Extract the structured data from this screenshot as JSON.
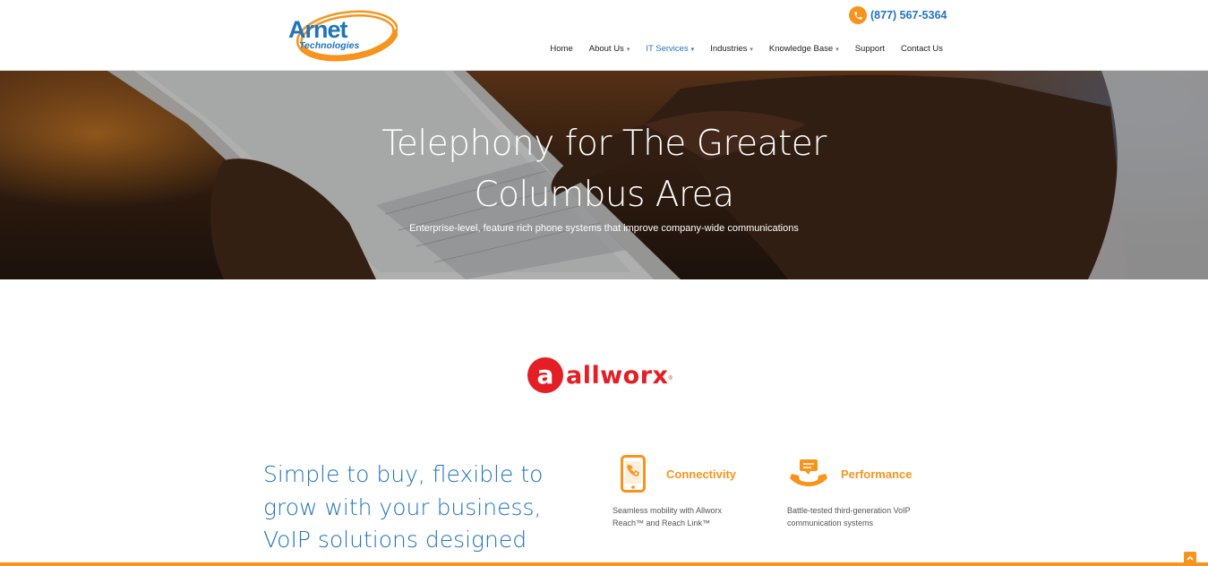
{
  "header": {
    "logo": {
      "line1": "Arnet",
      "line2": "Technologies"
    },
    "phone": "(877) 567-5364",
    "nav": [
      {
        "label": "Home",
        "dropdown": false,
        "active": false
      },
      {
        "label": "About Us",
        "dropdown": true,
        "active": false
      },
      {
        "label": "IT Services",
        "dropdown": true,
        "active": true
      },
      {
        "label": "Industries",
        "dropdown": true,
        "active": false
      },
      {
        "label": "Knowledge Base",
        "dropdown": true,
        "active": false
      },
      {
        "label": "Support",
        "dropdown": false,
        "active": false
      },
      {
        "label": "Contact Us",
        "dropdown": false,
        "active": false
      }
    ]
  },
  "hero": {
    "title_line1": "Telephony for The Greater",
    "title_line2": "Columbus Area",
    "subtitle": "Enterprise-level, feature rich phone systems that improve company-wide communications"
  },
  "partner": {
    "mark": "a",
    "name": "allworx",
    "reg": "®"
  },
  "tagline": "Simple to buy, flexible to grow with your business, VoIP solutions designed",
  "features": [
    {
      "title": "Connectivity",
      "icon": "mobile-phone-icon",
      "desc": "Seamless mobility with Allworx Reach™ and Reach Link™"
    },
    {
      "title": "Performance",
      "icon": "handset-chat-icon",
      "desc": "Battle-tested third-generation VoIP communication systems"
    }
  ],
  "colors": {
    "brand_blue": "#1f74bc",
    "accent_orange": "#f7941d",
    "allworx_red": "#e31e24"
  }
}
